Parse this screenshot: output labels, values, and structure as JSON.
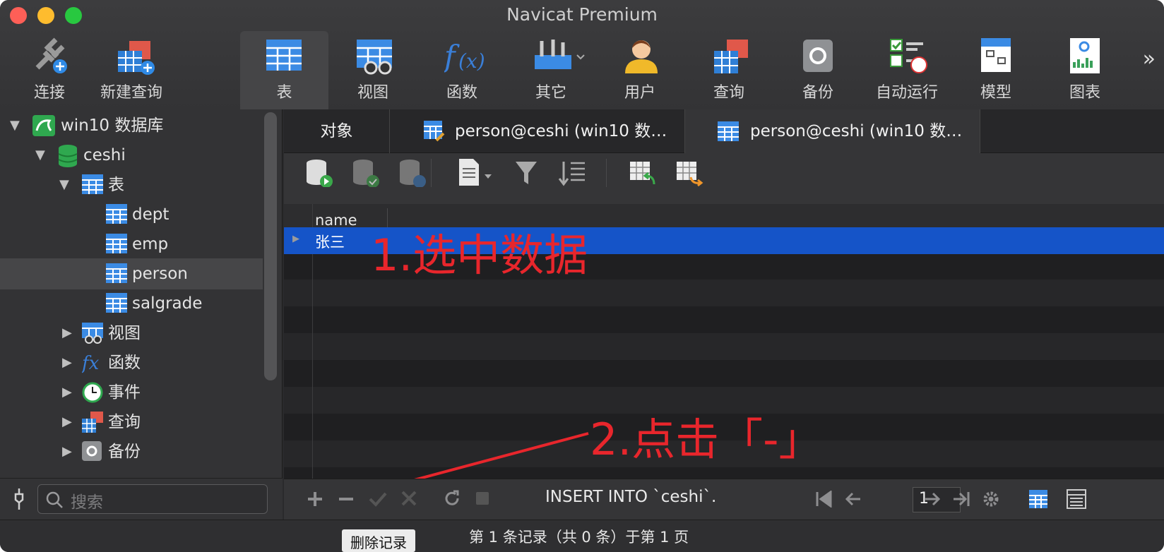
{
  "window": {
    "title": "Navicat Premium"
  },
  "toolbar": {
    "items": [
      {
        "label": "连接"
      },
      {
        "label": "新建查询"
      },
      {
        "label": "表"
      },
      {
        "label": "视图"
      },
      {
        "label": "函数"
      },
      {
        "label": "其它"
      },
      {
        "label": "用户"
      },
      {
        "label": "查询"
      },
      {
        "label": "备份"
      },
      {
        "label": "自动运行"
      },
      {
        "label": "模型"
      },
      {
        "label": "图表"
      }
    ],
    "more": "»"
  },
  "sidebar": {
    "connection": "win10 数据库",
    "database": "ceshi",
    "tables_group": "表",
    "tables": [
      "dept",
      "emp",
      "person",
      "salgrade"
    ],
    "groups": [
      "视图",
      "函数",
      "事件",
      "查询",
      "备份"
    ],
    "search_placeholder": "搜索"
  },
  "tabs": [
    {
      "label": "对象"
    },
    {
      "label": "person@ceshi (win10 数…"
    },
    {
      "label": "person@ceshi (win10 数…"
    }
  ],
  "grid": {
    "column": "name",
    "rows": [
      {
        "name": "张三"
      }
    ]
  },
  "annotations": {
    "step1": "1.选中数据",
    "step2": "2.点击「-」"
  },
  "bottombar": {
    "sql": "INSERT INTO `ceshi`.",
    "page": "1"
  },
  "status": {
    "text": "第 1 条记录（共 0 条）于第 1 页",
    "tooltip": "删除记录"
  },
  "colors": {
    "selection": "#1554c8",
    "annotation": "#e8262c"
  }
}
